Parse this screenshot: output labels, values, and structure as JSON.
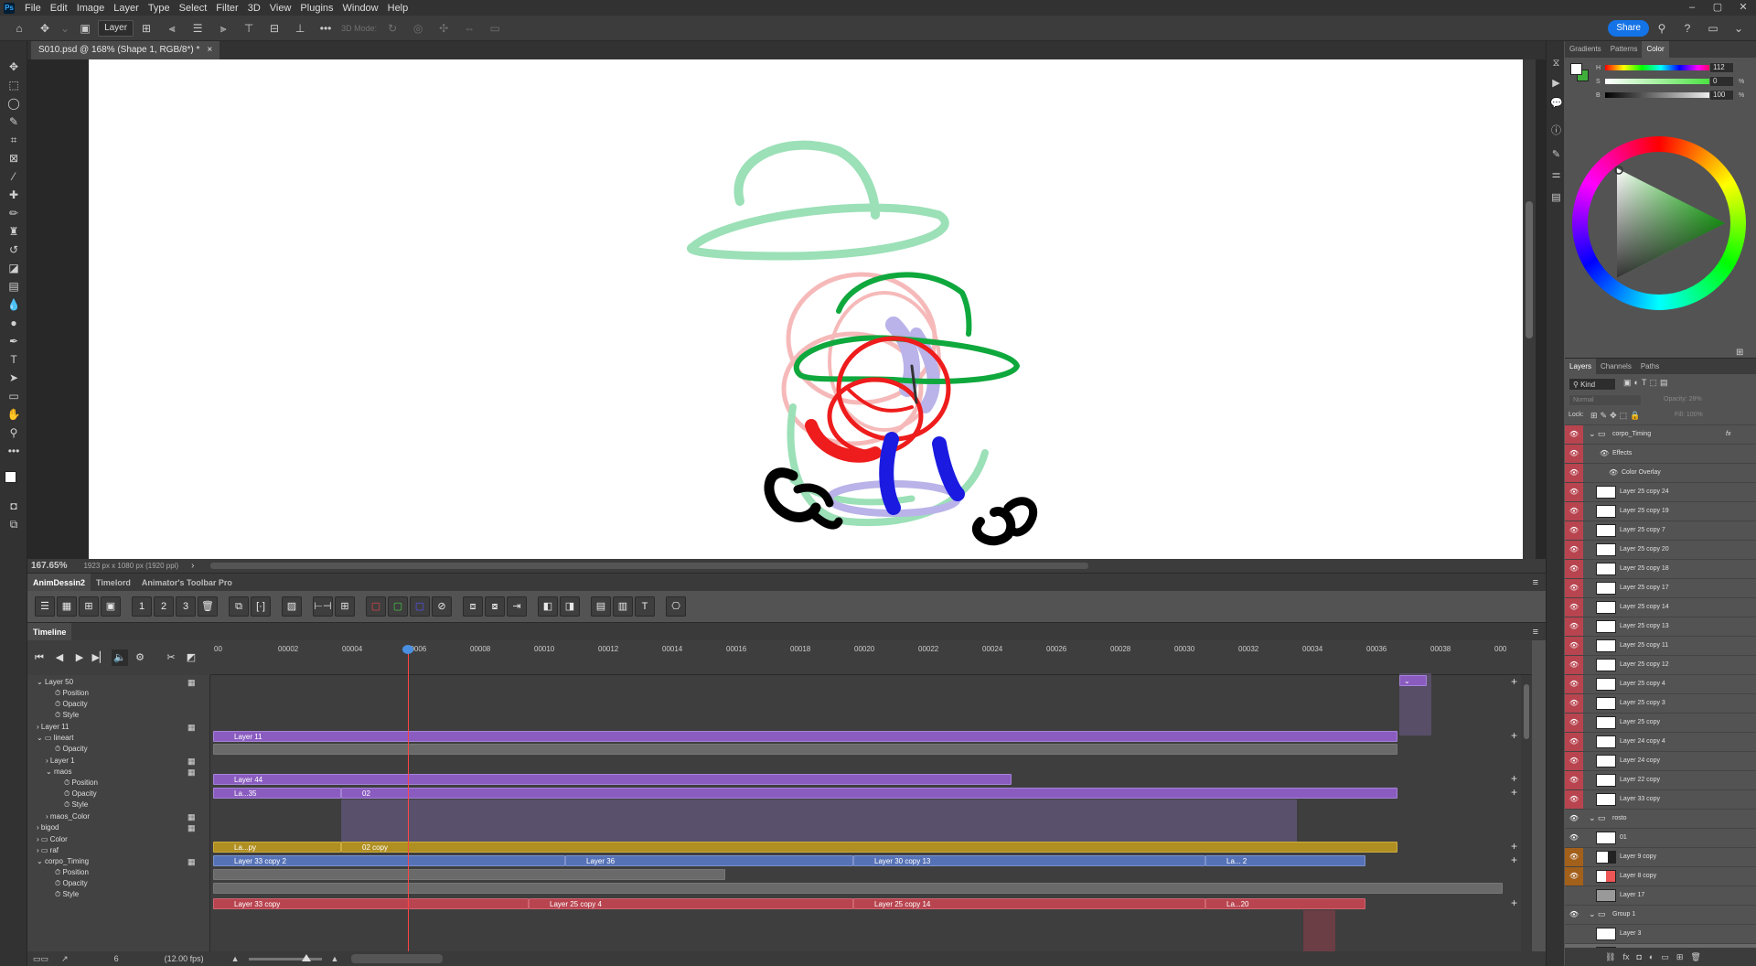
{
  "menu": {
    "items": [
      "File",
      "Edit",
      "Image",
      "Layer",
      "Type",
      "Select",
      "Filter",
      "3D",
      "View",
      "Plugins",
      "Window",
      "Help"
    ],
    "ps_logo": "Ps"
  },
  "options_bar": {
    "layer_select": "Layer",
    "mode_3d": "3D Mode:",
    "share_label": "Share"
  },
  "document": {
    "tab_title": "S010.psd @ 168% (Shape 1, RGB/8*) *",
    "close": "×",
    "zoom": "167.65%",
    "dimensions": "1923 px x 1080 px (1920 ppi)",
    "status_arrow": "›"
  },
  "anim_panel": {
    "tabs": [
      "AnimDessin2",
      "Timelord",
      "Animator's Toolbar Pro"
    ],
    "hamburger": "≡"
  },
  "timeline": {
    "title": "Timeline",
    "ticks": [
      "00",
      "00002",
      "00004",
      "00006",
      "00008",
      "00010",
      "00012",
      "00014",
      "00016",
      "00018",
      "00020",
      "00022",
      "00024",
      "00026",
      "00028",
      "00030",
      "00032",
      "00034",
      "00036",
      "00038",
      "000"
    ],
    "frame": "6",
    "fps": "(12.00 fps)",
    "layers": [
      {
        "name": "Layer 50",
        "indent": 1,
        "expander": "⌄"
      },
      {
        "name": "Position",
        "indent": 3,
        "prop": true
      },
      {
        "name": "Opacity",
        "indent": 3,
        "prop": true
      },
      {
        "name": "Style",
        "indent": 3,
        "prop": true
      },
      {
        "name": "Layer 11",
        "indent": 1,
        "expander": "›"
      },
      {
        "name": "lineart",
        "indent": 1,
        "expander": "⌄",
        "folder": true
      },
      {
        "name": "Opacity",
        "indent": 3,
        "prop": true
      },
      {
        "name": "Layer 1",
        "indent": 2,
        "expander": "›"
      },
      {
        "name": "maos",
        "indent": 2,
        "expander": "⌄"
      },
      {
        "name": "Position",
        "indent": 4,
        "prop": true
      },
      {
        "name": "Opacity",
        "indent": 4,
        "prop": true
      },
      {
        "name": "Style",
        "indent": 4,
        "prop": true
      },
      {
        "name": "maos_Color",
        "indent": 2,
        "expander": "›"
      },
      {
        "name": "bigod",
        "indent": 1,
        "expander": "›"
      },
      {
        "name": "Color",
        "indent": 1,
        "expander": "›",
        "folder": true
      },
      {
        "name": "raf",
        "indent": 1,
        "expander": "›",
        "folder": true
      },
      {
        "name": "corpo_Timing",
        "indent": 1,
        "expander": "⌄"
      },
      {
        "name": "Position",
        "indent": 3,
        "prop": true
      },
      {
        "name": "Opacity",
        "indent": 3,
        "prop": true
      },
      {
        "name": "Style",
        "indent": 3,
        "prop": true
      }
    ],
    "clips": {
      "layer11": "Layer 11",
      "layer44": "Layer 44",
      "maos_a": "La...35",
      "maos_b": "02",
      "maosc_a": "La...py",
      "maosc_b": "02 copy",
      "bigod_a": "Layer 33 copy 2",
      "bigod_b": "Layer 36",
      "bigod_c": "Layer 30 copy 13",
      "bigod_d": "La... 2",
      "corpo_a": "Layer 33 copy",
      "corpo_b": "Layer 25 copy 4",
      "corpo_c": "Layer 25 copy 14",
      "corpo_d": "La...20"
    }
  },
  "right_panel": {
    "top_tabs": [
      "Gradients",
      "Patterns",
      "Color"
    ],
    "sliders": [
      {
        "label": "H",
        "value": "112",
        "unit": ""
      },
      {
        "label": "S",
        "value": "0",
        "unit": "%"
      },
      {
        "label": "B",
        "value": "100",
        "unit": "%"
      }
    ],
    "layers_tabs": [
      "Layers",
      "Channels",
      "Paths"
    ],
    "kind": "Kind",
    "blend": "Normal",
    "opacity": "Opacity: 28%",
    "lock": "Lock:",
    "fill": "Fill: 100%",
    "layers": [
      {
        "name": "corpo_Timing",
        "type": "group",
        "eye": "red",
        "fx": true
      },
      {
        "name": "Effects",
        "type": "effect",
        "eye": "red"
      },
      {
        "name": "Color Overlay",
        "type": "effect2",
        "eye": "red"
      },
      {
        "name": "Layer 25 copy 24",
        "eye": "red"
      },
      {
        "name": "Layer 25 copy 19",
        "eye": "red"
      },
      {
        "name": "Layer 25 copy 7",
        "eye": "red"
      },
      {
        "name": "Layer 25 copy 20",
        "eye": "red"
      },
      {
        "name": "Layer 25 copy 18",
        "eye": "red"
      },
      {
        "name": "Layer 25 copy 17",
        "eye": "red"
      },
      {
        "name": "Layer 25 copy 14",
        "eye": "red"
      },
      {
        "name": "Layer 25 copy 13",
        "eye": "red"
      },
      {
        "name": "Layer 25 copy 11",
        "eye": "red"
      },
      {
        "name": "Layer 25 copy 12",
        "eye": "red"
      },
      {
        "name": "Layer 25 copy 4",
        "eye": "red"
      },
      {
        "name": "Layer 25 copy 3",
        "eye": "red"
      },
      {
        "name": "Layer 25 copy",
        "eye": "red"
      },
      {
        "name": "Layer 24 copy 4",
        "eye": "red"
      },
      {
        "name": "Layer 24 copy",
        "eye": "red"
      },
      {
        "name": "Layer 22 copy",
        "eye": "red"
      },
      {
        "name": "Layer 33 copy",
        "eye": "red"
      },
      {
        "name": "rosto",
        "type": "group",
        "eye": "none"
      },
      {
        "name": "01",
        "eye": "none"
      },
      {
        "name": "Layer 9 copy",
        "eye": "orange"
      },
      {
        "name": "Layer 8 copy",
        "eye": "orange"
      },
      {
        "name": "Layer 17",
        "eye": "none"
      },
      {
        "name": "Group 1",
        "type": "group",
        "eye": "none"
      },
      {
        "name": "Layer 3",
        "eye": "none"
      },
      {
        "name": "Shape 1",
        "eye": "none",
        "selected": true
      }
    ]
  }
}
